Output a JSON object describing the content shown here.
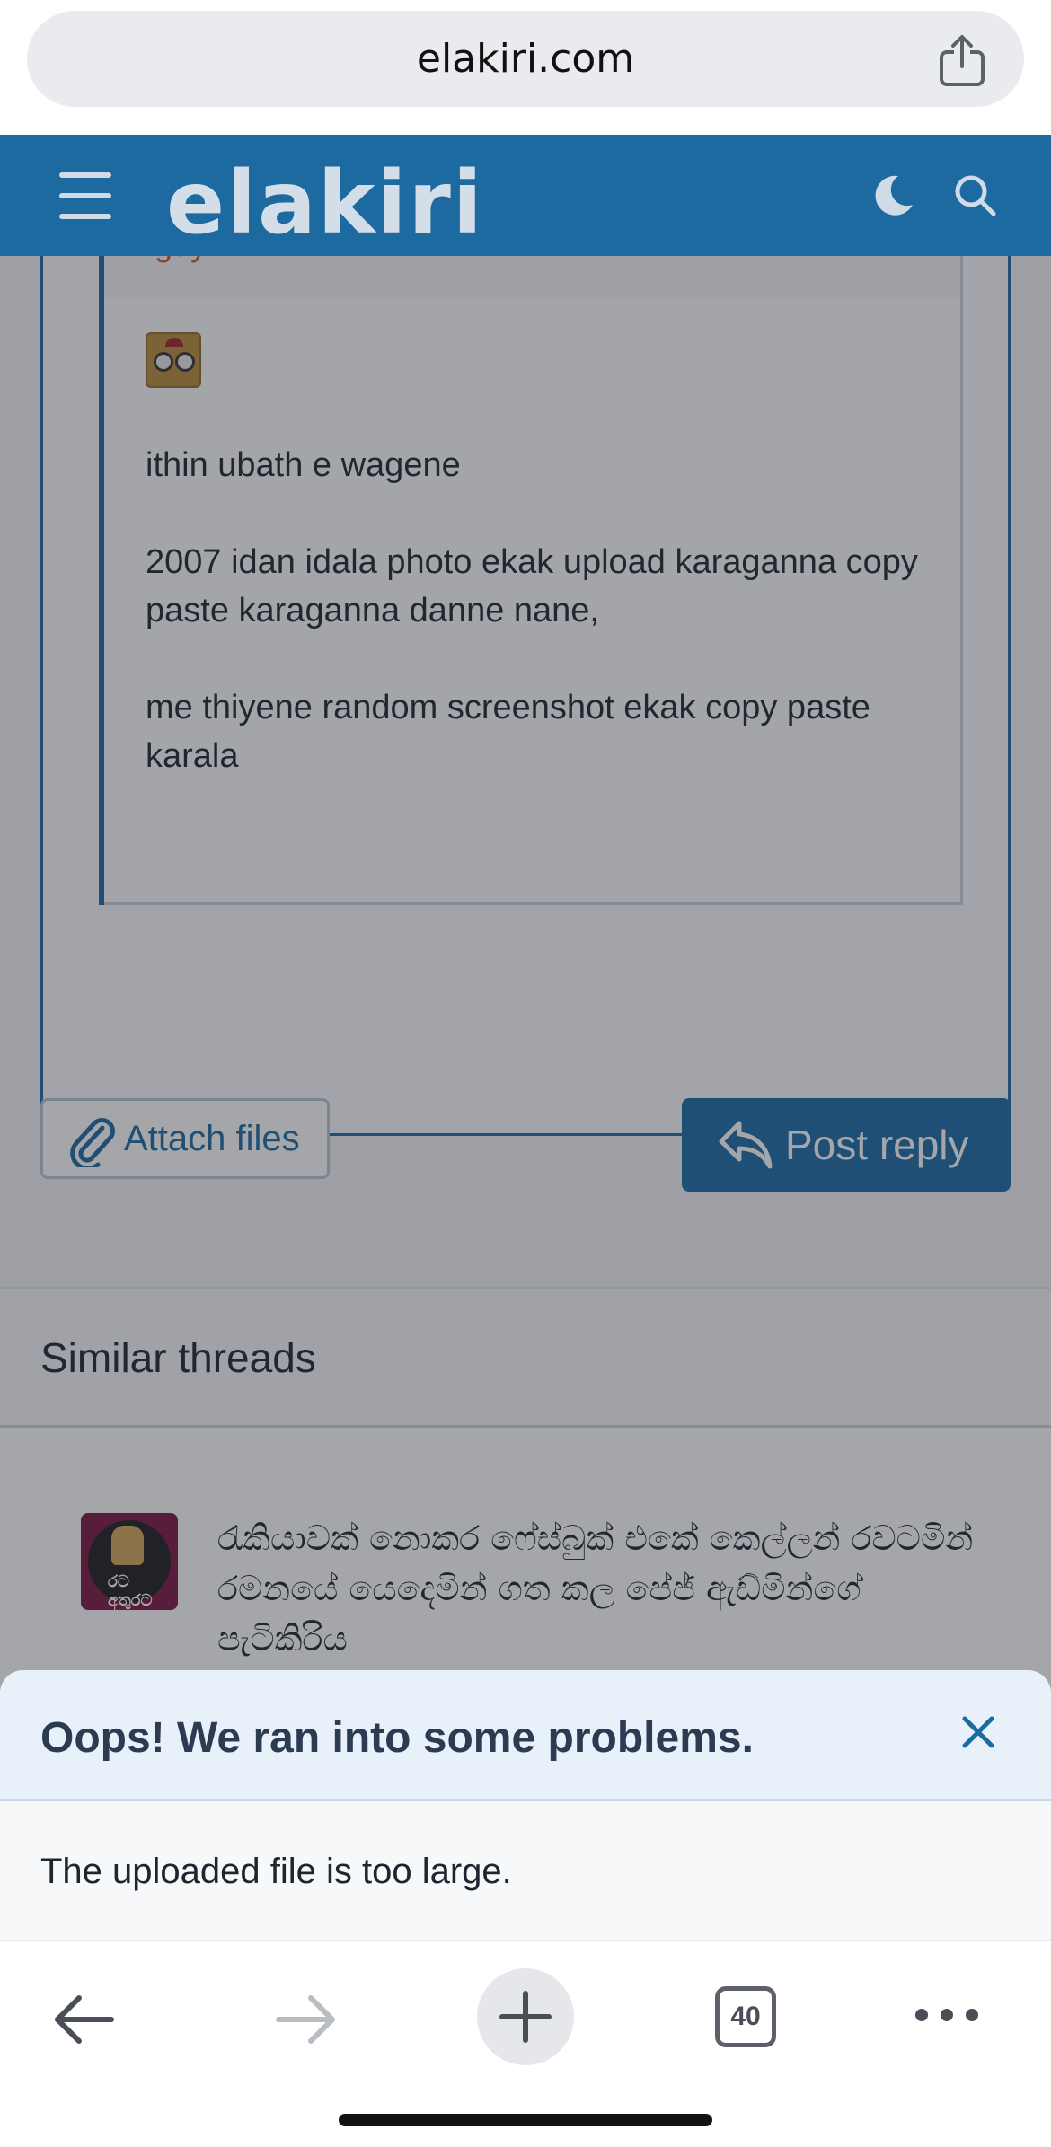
{
  "browser": {
    "url": "elakiri.com",
    "share_icon": "share-icon",
    "toolbar": {
      "back_icon": "arrow-left-icon",
      "forward_icon": "arrow-right-icon",
      "new_tab_icon": "plus-icon",
      "tab_count": "40",
      "more_icon": "ellipsis-icon"
    }
  },
  "header": {
    "logo_text": "elakiri",
    "menu_icon": "hamburger-icon",
    "theme_icon": "moon-icon",
    "search_icon": "search-icon",
    "brand_color": "#1d6aa0"
  },
  "editor": {
    "quote": {
      "author": "Iguy . . .",
      "emoji_icon": "eyes-emoji-icon",
      "paragraphs": [
        "ithin ubath e wagene",
        "2007 idan idala photo ekak upload karaganna copy paste karaganna danne nane,",
        "me thiyene random screenshot ekak copy paste karala"
      ]
    },
    "attach_label": "Attach files",
    "post_reply_label": "Post reply"
  },
  "similar_threads": {
    "title": "Similar threads",
    "items": [
      {
        "title": "රැකියාවක් නොකර ෆේස්බුක් එකේ කෙල්ලන් රවටමින් රමනයේ යෙදෙමින් ගත කල පේජ් ඇඩ්මින්ගේ පැටිකිරිය",
        "avatar_text": "රට අතුරට"
      }
    ]
  },
  "error_overlay": {
    "title": "Oops! We ran into some problems.",
    "message": "The uploaded file is too large.",
    "close_icon": "close-icon"
  }
}
